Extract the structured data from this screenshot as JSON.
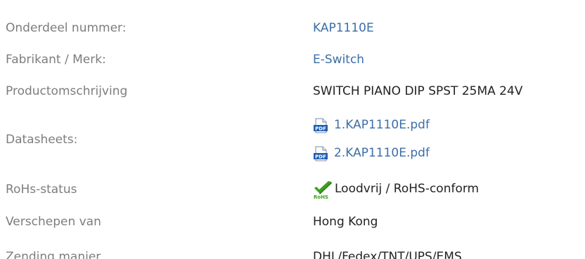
{
  "rows": [
    {
      "label": "Onderdeel nummer:",
      "value": "KAP1110E"
    },
    {
      "label": "Fabrikant / Merk:",
      "value": "E-Switch"
    },
    {
      "label": "Productomschrijving",
      "value": "SWITCH PIANO DIP SPST 25MA 24V"
    },
    {
      "label": "Datasheets:",
      "files": [
        "1.KAP1110E.pdf",
        "2.KAP1110E.pdf"
      ]
    },
    {
      "label": "RoHs-status",
      "value": "Loodvrij / RoHS-conform"
    },
    {
      "label": "Verschepen van",
      "value": "Hong Kong"
    },
    {
      "label": "Zending manier",
      "value": "DHL/Fedex/TNT/UPS/EMS"
    }
  ],
  "icons": {
    "pdf": "pdf-icon",
    "rohs": "rohs-check-icon"
  },
  "colors": {
    "label": "#7d7d7d",
    "link": "#3c6ea8",
    "value": "#222222",
    "pdf": "#1f5fb0",
    "rohs": "#3aa11c"
  }
}
